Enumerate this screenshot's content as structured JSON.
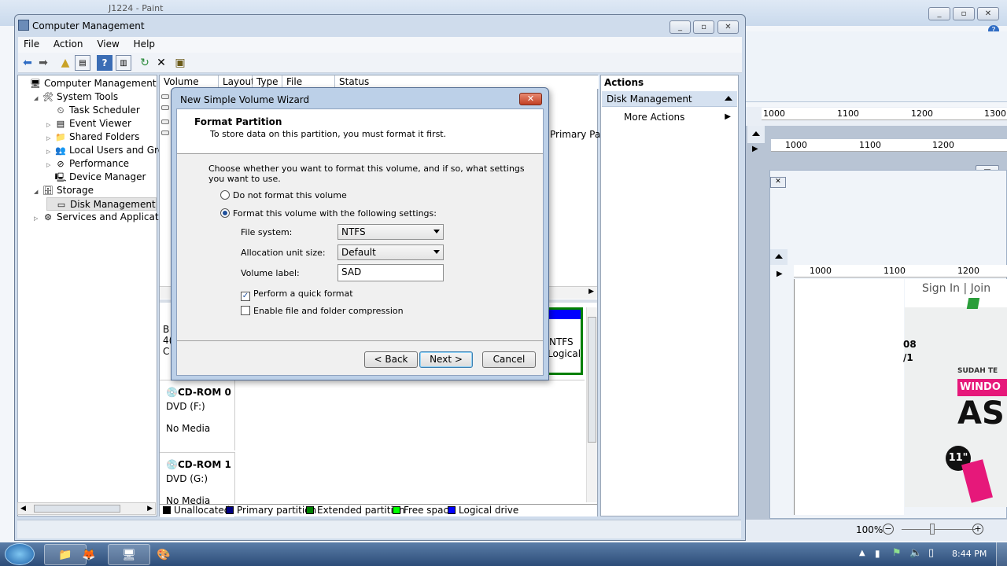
{
  "background_app": {
    "title_fragment": "J1224 - Paint",
    "ruler_labels_1": [
      "1000",
      "1100",
      "1200",
      "1300"
    ],
    "ruler_labels_2": [
      "1000",
      "1100",
      "1200"
    ],
    "ruler_labels_3": [
      "1000",
      "1100",
      "1200"
    ],
    "web_signin": "Sign In | Join",
    "web_text_1": "SUDAH TE",
    "web_text_2": "WINDO",
    "web_text_3": "AS",
    "web_badge": "11\"",
    "web_digits": "08",
    "web_digits2": "/1",
    "zoom": "100%"
  },
  "window": {
    "title": "Computer Management",
    "menu": [
      "File",
      "Action",
      "View",
      "Help"
    ]
  },
  "tree": {
    "items": [
      {
        "label": "Computer Management (Local",
        "indent": 0,
        "icon": "computer-icon"
      },
      {
        "label": "System Tools",
        "indent": 1,
        "icon": "tools-icon"
      },
      {
        "label": "Task Scheduler",
        "indent": 2,
        "icon": "clock-icon"
      },
      {
        "label": "Event Viewer",
        "indent": 2,
        "icon": "event-icon"
      },
      {
        "label": "Shared Folders",
        "indent": 2,
        "icon": "folder-icon"
      },
      {
        "label": "Local Users and Groups",
        "indent": 2,
        "icon": "users-icon"
      },
      {
        "label": "Performance",
        "indent": 2,
        "icon": "performance-icon"
      },
      {
        "label": "Device Manager",
        "indent": 2,
        "icon": "device-icon"
      },
      {
        "label": "Storage",
        "indent": 1,
        "icon": "storage-icon"
      },
      {
        "label": "Disk Management",
        "indent": 2,
        "icon": "disk-icon"
      },
      {
        "label": "Services and Applications",
        "indent": 1,
        "icon": "services-icon"
      }
    ]
  },
  "volume_list": {
    "columns": [
      "Volume",
      "Layout",
      "Type",
      "File System",
      "Status"
    ],
    "partial_status": "Primary Part"
  },
  "disks": {
    "partial_b": "B",
    "partial_4": "4(",
    "partial_c": "C",
    "ntfs": "NTFS",
    "logical": "Logical",
    "cdrom0": {
      "name": "CD-ROM 0",
      "drive": "DVD (F:)",
      "media": "No Media"
    },
    "cdrom1": {
      "name": "CD-ROM 1",
      "drive": "DVD (G:)",
      "media": "No Media"
    }
  },
  "legend": [
    {
      "label": "Unallocated",
      "color": "#000000"
    },
    {
      "label": "Primary partition",
      "color": "#000080"
    },
    {
      "label": "Extended partition",
      "color": "#008000"
    },
    {
      "label": "Free space",
      "color": "#00ff00"
    },
    {
      "label": "Logical drive",
      "color": "#0000ff"
    }
  ],
  "actions": {
    "header": "Actions",
    "section": "Disk Management",
    "more": "More Actions"
  },
  "dialog": {
    "title": "New Simple Volume Wizard",
    "heading": "Format Partition",
    "subheading": "To store data on this partition, you must format it first.",
    "instruction": "Choose whether you want to format this volume, and if so, what settings you want to use.",
    "radio_no_format": "Do not format this volume",
    "radio_format": "Format this volume with the following settings:",
    "fs_label": "File system:",
    "fs_value": "NTFS",
    "alloc_label": "Allocation unit size:",
    "alloc_value": "Default",
    "vol_label": "Volume label:",
    "vol_value": "SAD",
    "quick_format": "Perform a quick format",
    "compression": "Enable file and folder compression",
    "back": "< Back",
    "next": "Next >",
    "cancel": "Cancel"
  },
  "taskbar": {
    "clock": "8:44 PM"
  }
}
